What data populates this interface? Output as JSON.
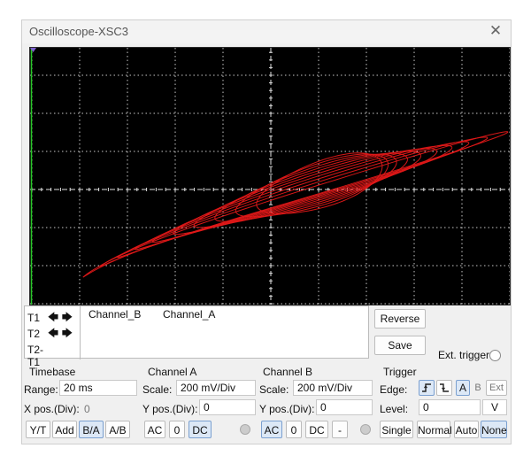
{
  "window": {
    "title": "Oscilloscope-XSC3",
    "close_glyph": "✕"
  },
  "cursor_panel": {
    "rows": [
      {
        "label": "T1",
        "left": "🡄",
        "right": "🡆"
      },
      {
        "label": "T2",
        "left": "🡄",
        "right": "🡆"
      },
      {
        "label": "T2-T1"
      }
    ],
    "columns": [
      "Channel_B",
      "Channel_A"
    ]
  },
  "buttons": {
    "reverse": "Reverse",
    "save": "Save"
  },
  "ext_trigger": {
    "label": "Ext. trigger"
  },
  "timebase": {
    "title": "Timebase",
    "range_label": "Range:",
    "range_value": "20 ms",
    "xpos_label": "X pos.(Div):",
    "xpos_value": "0",
    "modes": [
      "Y/T",
      "Add",
      "B/A",
      "A/B"
    ],
    "selected_mode": "B/A"
  },
  "channel_a": {
    "title": "Channel A",
    "scale_label": "Scale:",
    "scale_value": "200 mV/Div",
    "ypos_label": "Y pos.(Div):",
    "ypos_value": "0",
    "coupling": [
      "AC",
      "0",
      "DC"
    ],
    "selected": "DC"
  },
  "channel_b": {
    "title": "Channel B",
    "scale_label": "Scale:",
    "scale_value": "200 mV/Div",
    "ypos_label": "Y pos.(Div):",
    "ypos_value": "0",
    "coupling": [
      "AC",
      "0",
      "DC",
      "-"
    ],
    "selected": "AC"
  },
  "trigger": {
    "title": "Trigger",
    "edge_label": "Edge:",
    "edge_options": [
      "A",
      "B",
      "Ext"
    ],
    "selected_edge_source": "A",
    "level_label": "Level:",
    "level_value": "0",
    "level_unit": "V",
    "modes": [
      "Single",
      "Normal",
      "Auto",
      "None"
    ],
    "selected_mode": "None"
  },
  "colors": {
    "trace": "#e01818",
    "grid": "#c8c8c8",
    "screen_bg": "#000000",
    "selected_button": "#dce8f6"
  }
}
